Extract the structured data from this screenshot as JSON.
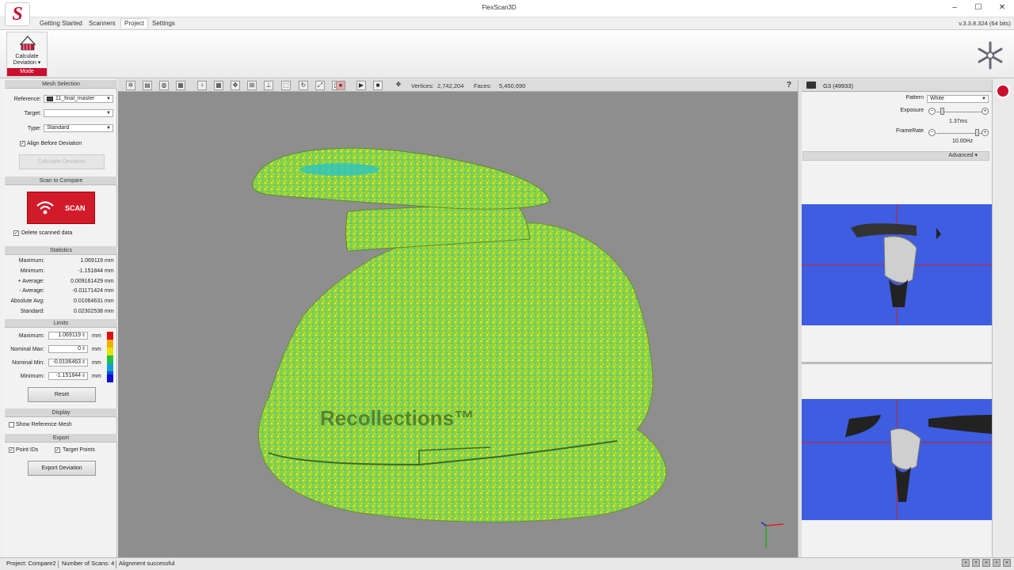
{
  "window": {
    "title": "FlexScan3D",
    "version": "v.3.3.8.324 (64 bits)",
    "controls": [
      "–",
      "☐",
      "✕"
    ]
  },
  "menu": {
    "items": [
      "Getting Started",
      "Scanners",
      "Project",
      "Settings"
    ],
    "active": "Project"
  },
  "ribbon": {
    "mode_button_label": "Calculate Deviation ▾",
    "mode_caption": "Mode"
  },
  "left_panel": {
    "mesh_selection": {
      "header": "Mesh Selection",
      "reference_label": "Reference:",
      "reference_value": "11_final_master",
      "target_label": "Target:",
      "target_value": "",
      "type_label": "Type:",
      "type_value": "Standard",
      "align_label": "Align Before Deviation",
      "align_checked": true,
      "calc_button": "Calculate Deviation"
    },
    "scan_to_compare": {
      "header": "Scan to Compare",
      "scan_button": "SCAN",
      "delete_label": "Delete scanned data",
      "delete_checked": true
    },
    "statistics": {
      "header": "Statistics",
      "rows": [
        {
          "label": "Maximum:",
          "value": "1.069119",
          "unit": "mm"
        },
        {
          "label": "Minimum:",
          "value": "-1.151844",
          "unit": "mm"
        },
        {
          "label": "+ Average:",
          "value": "0.009161429",
          "unit": "mm"
        },
        {
          "label": "- Average:",
          "value": "-0.01171424",
          "unit": "mm"
        },
        {
          "label": "Absolute Avg:",
          "value": "0.01064631",
          "unit": "mm"
        },
        {
          "label": "Standard:",
          "value": "0.02302538",
          "unit": "mm"
        }
      ]
    },
    "limits": {
      "header": "Limits",
      "rows": [
        {
          "label": "Maximum:",
          "value": "1.069119",
          "unit": "mm"
        },
        {
          "label": "Nominal Max:",
          "value": "0",
          "unit": "mm"
        },
        {
          "label": "Nominal Min:",
          "value": "-0.0106463",
          "unit": "mm"
        },
        {
          "label": "Minimum:",
          "value": "-1.151844",
          "unit": "mm"
        }
      ],
      "reset_button": "Reset",
      "colors": [
        "#e01010",
        "#f2b000",
        "#e8e000",
        "#22c040",
        "#10a0d0",
        "#1050e0",
        "#1010d0"
      ]
    },
    "display": {
      "header": "Display",
      "show_ref_label": "Show Reference Mesh",
      "show_ref_checked": false
    },
    "export": {
      "header": "Export",
      "point_ids_label": "Point IDs",
      "point_ids_checked": true,
      "target_points_label": "Target Points",
      "target_points_checked": true,
      "export_button": "Export Deviation"
    }
  },
  "viewport": {
    "toolbar_icons": [
      "select-icon",
      "grid-icon",
      "sphere-icon",
      "texture-icon",
      "light-icon",
      "mesh-icon",
      "move-icon",
      "crop-icon",
      "axis-icon",
      "box-icon",
      "rotate-icon",
      "fit-icon",
      "view-icon",
      "record-icon",
      "play-icon",
      "stop-icon",
      "pan-icon"
    ],
    "vertices_label": "Vertices:",
    "vertices_value": "2,742,204",
    "faces_label": "Faces:",
    "faces_value": "5,450,690",
    "help": "?",
    "model_text": "Recollections™"
  },
  "right_panel": {
    "camera_name": "G3 (49933)",
    "pattern_label": "Pattern",
    "pattern_value": "White",
    "exposure_label": "Exposure",
    "exposure_value": "1.37ms",
    "framerate_label": "FrameRate",
    "framerate_value": "10.00Hz",
    "advanced_label": "Advanced ▾"
  },
  "status_bar": {
    "project": "Project:  Compare2",
    "scans": "Number of Scans:  4",
    "alignment": "Alignment successful"
  }
}
